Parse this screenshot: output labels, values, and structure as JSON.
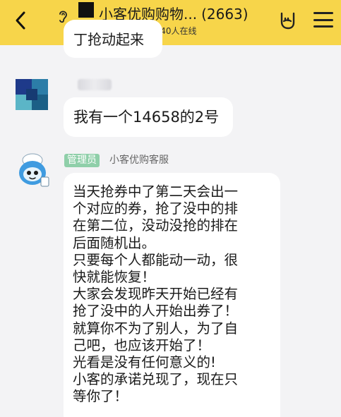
{
  "header": {
    "title": "小客优购购物...",
    "member_count": "(2663)",
    "online_text": "2240人在线"
  },
  "messages": {
    "cut_text": "丁抢动起来",
    "msg2": {
      "text": "我有一个14658的2号"
    },
    "msg3": {
      "badge": "管理员",
      "sender": "小客优购客服",
      "lines": [
        "当天抢券中了第二天会出一",
        "个对应的券，抢了没中的排",
        "在第二位，没动没抢的排在",
        "后面随机出。",
        "只要每个人都能动一动，很",
        "快就能恢复！",
        "大家会发现昨天开始已经有",
        "抢了没中的人开始出券了！",
        "就算你不为了别人，为了自",
        "己吧，也应该开始了！",
        "光看是没有任何意义的!",
        "小客的承诺兑现了，现在只",
        "等你了！"
      ]
    }
  },
  "colors": {
    "header_bg": "#f7d54a",
    "chat_bg": "#f3f3f5",
    "admin_badge": "#8fcfa9"
  }
}
